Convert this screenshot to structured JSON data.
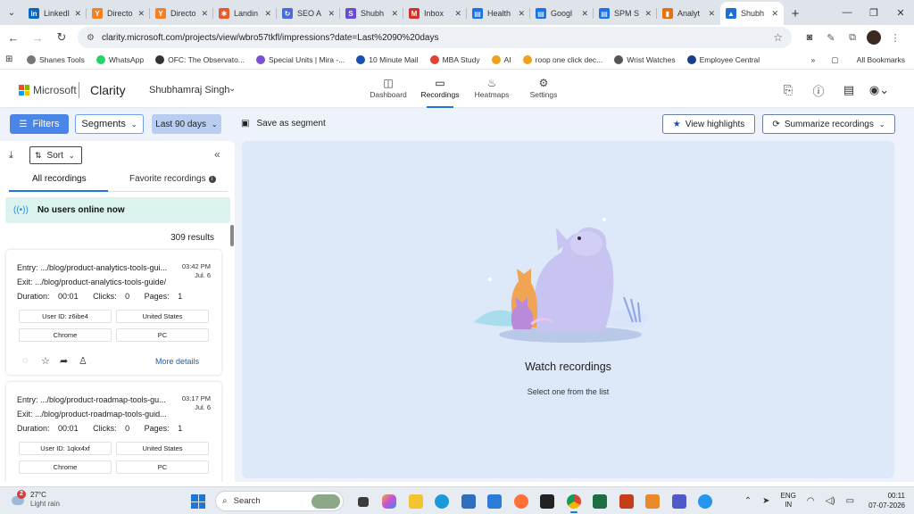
{
  "browser": {
    "tabs": [
      {
        "title": "LinkedI",
        "color": "#0a66c2",
        "glyph": "in"
      },
      {
        "title": "Directo",
        "color": "#f48024",
        "glyph": "Y"
      },
      {
        "title": "Directo",
        "color": "#f48024",
        "glyph": "Y"
      },
      {
        "title": "Landin",
        "color": "#e85b2b",
        "glyph": "✱"
      },
      {
        "title": "SEO A",
        "color": "#4a6bd8",
        "glyph": "↻"
      },
      {
        "title": "Shubh",
        "color": "#6a4bd8",
        "glyph": "S"
      },
      {
        "title": "Inbox",
        "color": "#d93025",
        "glyph": "M"
      },
      {
        "title": "Health",
        "color": "#1a73e8",
        "glyph": "▤"
      },
      {
        "title": "Googl",
        "color": "#1a73e8",
        "glyph": "▤"
      },
      {
        "title": "SPM S",
        "color": "#1a73e8",
        "glyph": "▤"
      },
      {
        "title": "Analyt",
        "color": "#e8710a",
        "glyph": "▮"
      },
      {
        "title": "Shubh",
        "color": "#1d6fd6",
        "glyph": "▲"
      }
    ],
    "active_tab_index": 11,
    "url": "clarity.microsoft.com/projects/view/wbro57tkfl/impressions?date=Last%2090%20days",
    "bookmarks": [
      {
        "label": "Shanes Tools",
        "color": "#777"
      },
      {
        "label": "WhatsApp",
        "color": "#25d366"
      },
      {
        "label": "OFC: The Observato...",
        "color": "#333"
      },
      {
        "label": "Special Units | Mira -...",
        "color": "#7b4fd1"
      },
      {
        "label": "10 Minute Mail",
        "color": "#1a4fb0"
      },
      {
        "label": "MBA Study",
        "color": "#e0442d"
      },
      {
        "label": "AI",
        "color": "#f0a020"
      },
      {
        "label": "roop one click dec...",
        "color": "#f0a020"
      },
      {
        "label": "Wrist Watches",
        "color": "#555"
      },
      {
        "label": "Employee Central",
        "color": "#1a3c8f"
      }
    ],
    "all_bookmarks_label": "All Bookmarks"
  },
  "header": {
    "brand": "Microsoft",
    "product": "Clarity",
    "project": "Shubhamraj Singh",
    "nav": [
      {
        "label": "Dashboard",
        "icon": "dashboard-icon",
        "glyph": "◫"
      },
      {
        "label": "Recordings",
        "icon": "recordings-icon",
        "glyph": "▭"
      },
      {
        "label": "Heatmaps",
        "icon": "heatmaps-icon",
        "glyph": "♨"
      },
      {
        "label": "Settings",
        "icon": "settings-icon",
        "glyph": "⚙"
      }
    ],
    "active_nav": "Recordings"
  },
  "toolbar": {
    "filters_label": "Filters",
    "segments_label": "Segments",
    "date_range_label": "Last 90 days",
    "save_segment_label": "Save as segment",
    "view_highlights_label": "View highlights",
    "summarize_label": "Summarize recordings"
  },
  "recordings_panel": {
    "sort_label": "Sort",
    "tab_all": "All recordings",
    "tab_favorites": "Favorite recordings",
    "online_status": "No users online now",
    "results_count": "309 results",
    "recordings": [
      {
        "entry": "Entry: .../blog/product-analytics-tools-gui...",
        "exit": "Exit: .../blog/product-analytics-tools-guide/",
        "time": "03:42 PM",
        "date": "Jul. 6",
        "duration_label": "Duration:",
        "duration": "00:01",
        "clicks_label": "Clicks:",
        "clicks": "0",
        "pages_label": "Pages:",
        "pages": "1",
        "user_id": "User ID: z6ibe4",
        "country": "United States",
        "browser": "Chrome",
        "device": "PC",
        "more_details": "More details"
      },
      {
        "entry": "Entry: .../blog/product-roadmap-tools-gu...",
        "exit": "Exit: .../blog/product-roadmap-tools-guid...",
        "time": "03:17 PM",
        "date": "Jul. 6",
        "duration_label": "Duration:",
        "duration": "00:01",
        "clicks_label": "Clicks:",
        "clicks": "0",
        "pages_label": "Pages:",
        "pages": "1",
        "user_id": "User ID: 1qkx4xf",
        "country": "United States",
        "browser": "Chrome",
        "device": "PC"
      }
    ]
  },
  "player": {
    "title": "Watch recordings",
    "subtitle": "Select one from the list"
  },
  "taskbar": {
    "temperature": "27°C",
    "condition": "Light rain",
    "notification_count": "2",
    "search_placeholder": "Search",
    "language": "ENG",
    "region": "IN",
    "time": "00:11",
    "date": "07-07-2026"
  },
  "colors": {
    "accent": "#4a86e8",
    "content_bg": "#eef3fb",
    "player_bg": "#dde8f8",
    "online_bg": "#dbf3ef"
  }
}
